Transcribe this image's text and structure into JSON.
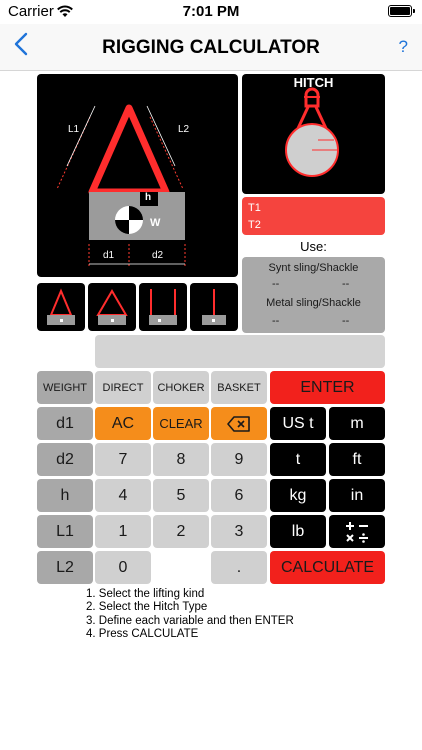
{
  "status_bar": {
    "carrier": "Carrier",
    "time": "7:01 PM"
  },
  "nav": {
    "title": "RIGGING CALCULATOR",
    "help": "?"
  },
  "diagram": {
    "L1": "L1",
    "L2": "L2",
    "h": "h",
    "W": "W",
    "d1": "d1",
    "d2": "d2"
  },
  "hitch": {
    "title": "HITCH"
  },
  "tensions": {
    "t1": "T1",
    "t2": "T2"
  },
  "use": {
    "label": "Use:",
    "synt_title": "Synt sling/Shackle",
    "synt_left": "--",
    "synt_right": "--",
    "metal_title": "Metal sling/Shackle",
    "metal_left": "--",
    "metal_right": "--"
  },
  "display": {
    "value": ""
  },
  "keys": {
    "weight": "WEIGHT",
    "direct": "DIRECT",
    "choker": "CHOKER",
    "basket": "BASKET",
    "enter": "ENTER",
    "d1": "d1",
    "ac": "AC",
    "clear": "CLEAR",
    "us_t": "US t",
    "m": "m",
    "d2": "d2",
    "seven": "7",
    "eight": "8",
    "nine": "9",
    "t": "t",
    "ft": "ft",
    "h": "h",
    "four": "4",
    "five": "5",
    "six": "6",
    "kg": "kg",
    "in": "in",
    "L1": "L1",
    "one": "1",
    "two": "2",
    "three": "3",
    "lb": "lb",
    "L2": "L2",
    "zero": "0",
    "dot": ".",
    "calculate": "CALCULATE"
  },
  "instructions": [
    "1. Select the lifting kind",
    "2. Select the Hitch Type",
    "3. Define each variable and then ENTER",
    "4. Press CALCULATE"
  ]
}
